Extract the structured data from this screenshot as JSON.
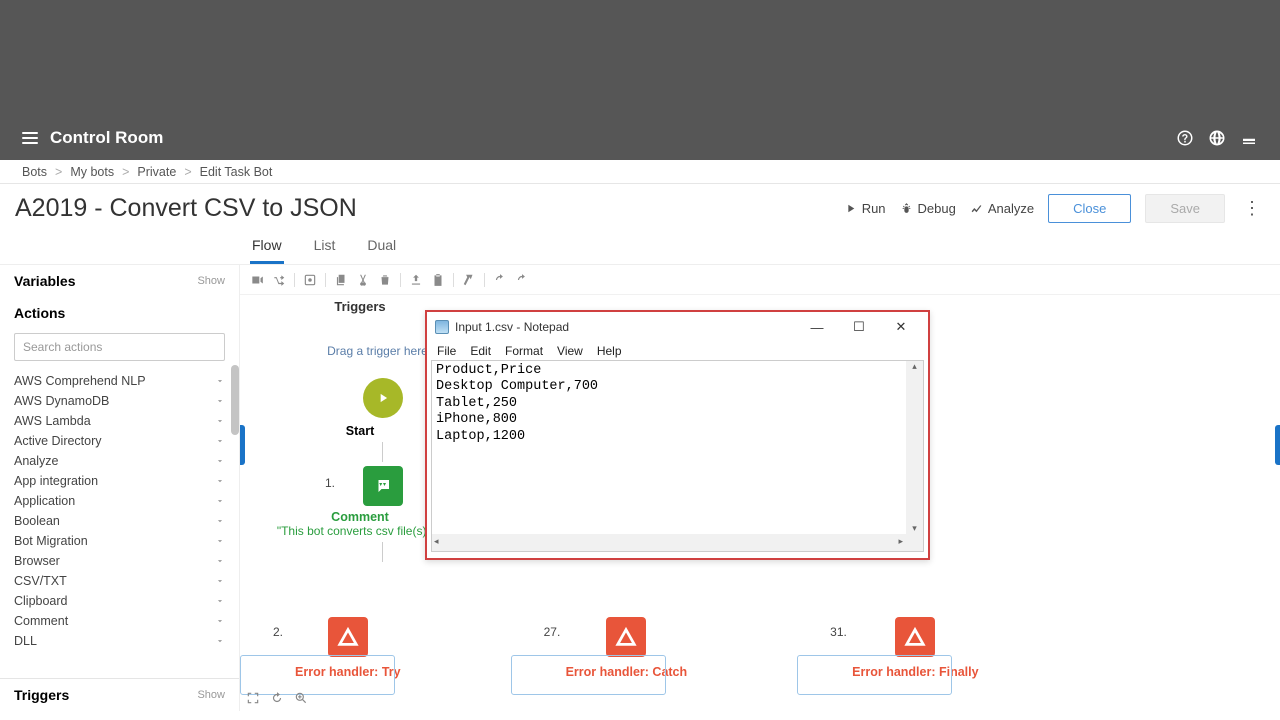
{
  "header": {
    "title": "Control Room"
  },
  "breadcrumbs": {
    "items": [
      "Bots",
      "My bots",
      "Private"
    ],
    "current": "Edit Task Bot"
  },
  "page": {
    "title": "A2019 - Convert CSV to JSON"
  },
  "actions": {
    "run": "Run",
    "debug": "Debug",
    "analyze": "Analyze",
    "close": "Close",
    "save": "Save"
  },
  "tabs": {
    "flow": "Flow",
    "list": "List",
    "dual": "Dual"
  },
  "sidebar": {
    "variables_label": "Variables",
    "actions_label": "Actions",
    "triggers_label": "Triggers",
    "show_label": "Show",
    "search_placeholder": "Search actions",
    "items": [
      "AWS Comprehend NLP",
      "AWS DynamoDB",
      "AWS Lambda",
      "Active Directory",
      "Analyze",
      "App integration",
      "Application",
      "Boolean",
      "Bot Migration",
      "Browser",
      "CSV/TXT",
      "Clipboard",
      "Comment",
      "DLL"
    ]
  },
  "flow": {
    "triggers_label": "Triggers",
    "drop_hint": "Drag a trigger here...",
    "start_label": "Start",
    "step1_num": "1.",
    "comment_label": "Comment",
    "comment_text": "\"This bot converts csv file(s) t...",
    "errors": [
      {
        "num": "2.",
        "label": "Error handler: Try"
      },
      {
        "num": "27.",
        "label": "Error handler: Catch"
      },
      {
        "num": "31.",
        "label": "Error handler: Finally"
      }
    ]
  },
  "notepad": {
    "title": "Input 1.csv - Notepad",
    "menu": [
      "File",
      "Edit",
      "Format",
      "View",
      "Help"
    ],
    "content": "Product,Price\nDesktop Computer,700\nTablet,250\niPhone,800\nLaptop,1200"
  }
}
